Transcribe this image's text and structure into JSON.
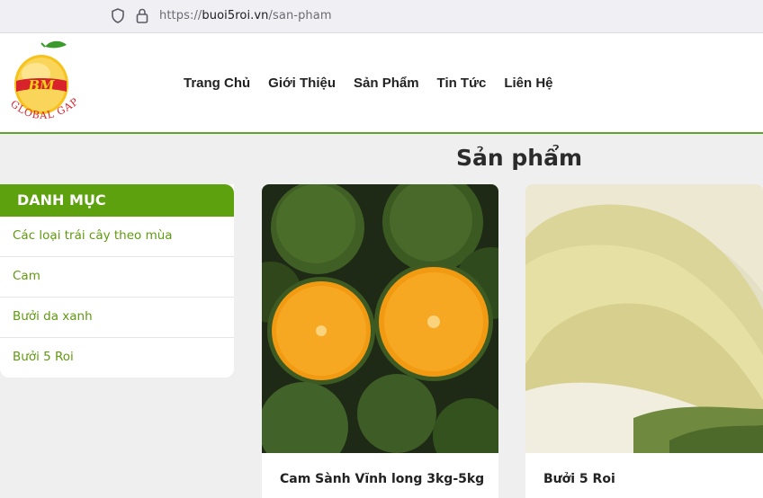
{
  "browser": {
    "url_scheme": "https://",
    "url_host": "buoi5roi.vn",
    "url_path": "/san-pham"
  },
  "header": {
    "logo_text_top": "BM",
    "logo_text_bottom": "GLOBAL GAP",
    "nav": [
      "Trang Chủ",
      "Giới Thiệu",
      "Sản Phẩm",
      "Tin Tức",
      "Liên Hệ"
    ]
  },
  "main": {
    "page_title": "Sản phẩm"
  },
  "sidebar": {
    "heading": "DANH MỤC",
    "items": [
      "Các loại trái cây theo mùa",
      "Cam",
      "Bưởi da xanh",
      "Bưởi 5 Roi"
    ]
  },
  "products": [
    {
      "name": "Cam Sành Vĩnh long 3kg-5kg"
    },
    {
      "name": "Bưởi 5 Roi"
    }
  ],
  "colors": {
    "accent_green": "#5ea10f",
    "link_green": "#5f9a10"
  }
}
